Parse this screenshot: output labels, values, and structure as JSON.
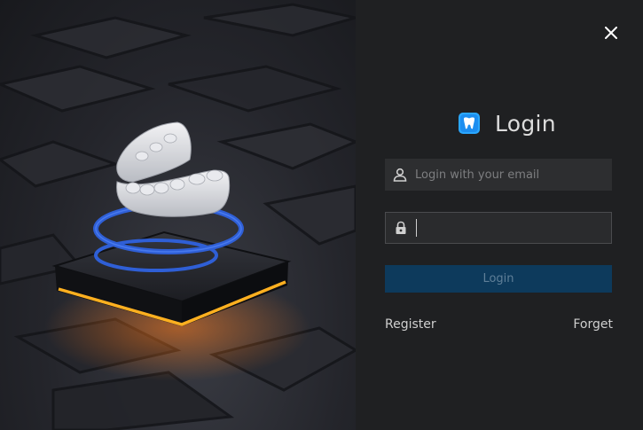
{
  "window": {
    "close_icon": "close-icon",
    "accent": "#0d3a5c"
  },
  "login": {
    "title": "Login",
    "logo_icon": "tooth-logo-icon",
    "email": {
      "placeholder": "Login with your email",
      "value": "",
      "icon": "user-icon"
    },
    "password": {
      "value": "",
      "icon": "lock-icon"
    },
    "submit_label": "Login",
    "register_label": "Register",
    "forget_label": "Forget"
  }
}
